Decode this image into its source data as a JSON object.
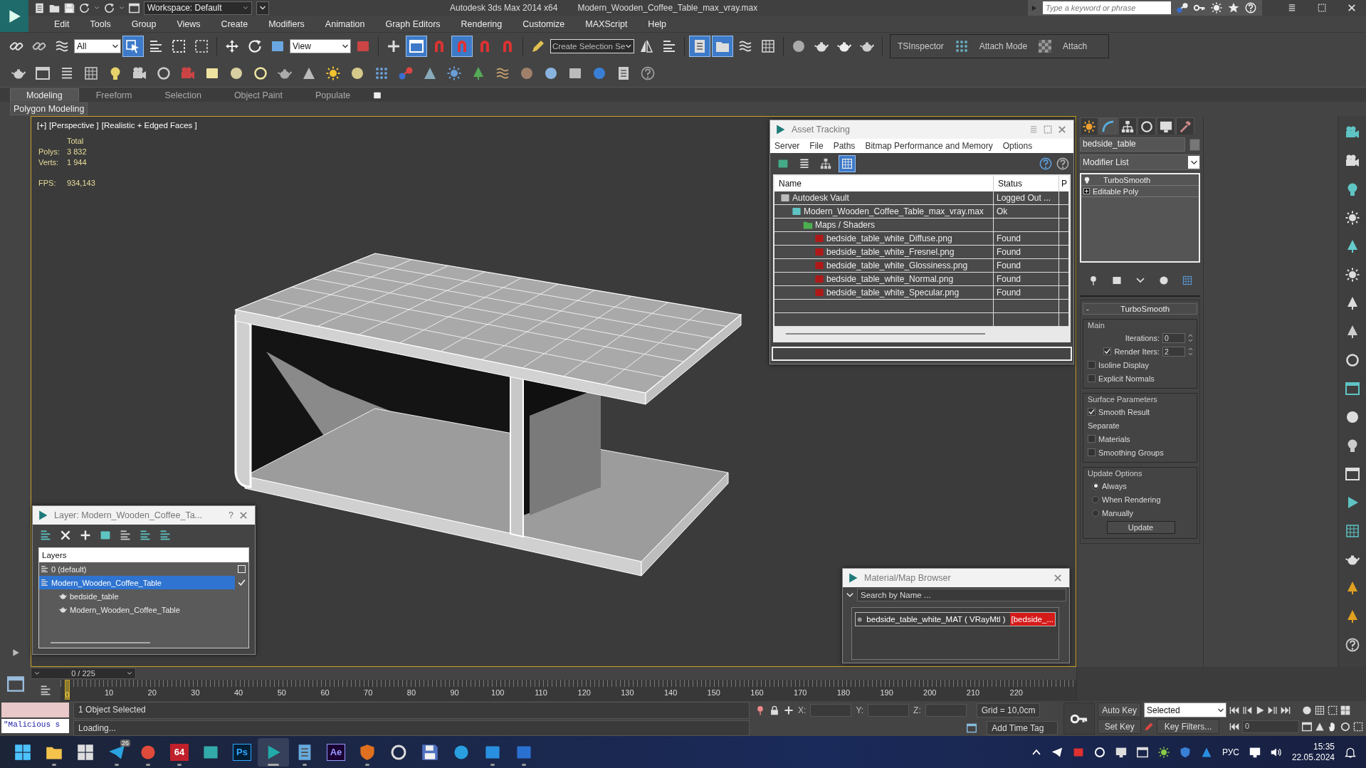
{
  "title_bar": {
    "workspace": "Workspace: Default",
    "app_title": "Autodesk 3ds Max  2014 x64",
    "file_name": "Modern_Wooden_Coffee_Table_max_vray.max",
    "search": {
      "placeholder": "Type a keyword or phrase"
    }
  },
  "menu": [
    "Edit",
    "Tools",
    "Group",
    "Views",
    "Create",
    "Modifiers",
    "Animation",
    "Graph Editors",
    "Rendering",
    "Customize",
    "MAXScript",
    "Help"
  ],
  "main_toolbar": [
    {
      "kind": "button",
      "selected": false
    },
    {
      "kind": "button",
      "selected": false
    },
    {
      "kind": "button",
      "selected": false
    },
    {
      "kind": "dropdown",
      "value": "All"
    },
    {
      "kind": "button",
      "selected": true
    },
    {
      "kind": "button",
      "selected": false
    },
    {
      "kind": "button",
      "selected": false
    },
    {
      "kind": "button",
      "selected": false
    },
    {
      "kind": "sep"
    },
    {
      "kind": "button",
      "selected": false
    },
    {
      "kind": "button",
      "selected": false
    },
    {
      "kind": "button",
      "selected": false
    },
    {
      "kind": "dropdown",
      "value": "View"
    },
    {
      "kind": "button",
      "selected": false
    },
    {
      "kind": "sep"
    },
    {
      "kind": "button",
      "selected": false
    },
    {
      "kind": "button",
      "selected": true
    },
    {
      "kind": "button",
      "selected": false
    },
    {
      "kind": "button",
      "selected": true
    },
    {
      "kind": "button",
      "selected": false
    },
    {
      "kind": "button",
      "selected": false
    },
    {
      "kind": "sep"
    },
    {
      "kind": "button",
      "selected": false
    },
    {
      "kind": "combo",
      "value": "Create Selection Se"
    },
    {
      "kind": "button",
      "selected": false
    },
    {
      "kind": "button",
      "selected": false
    },
    {
      "kind": "sep"
    },
    {
      "kind": "button",
      "selected": true
    },
    {
      "kind": "button",
      "selected": true
    },
    {
      "kind": "button",
      "selected": false
    },
    {
      "kind": "button",
      "selected": false
    },
    {
      "kind": "sep"
    },
    {
      "kind": "button",
      "selected": false
    },
    {
      "kind": "button",
      "selected": false
    },
    {
      "kind": "button",
      "selected": false
    },
    {
      "kind": "button",
      "selected": false
    },
    {
      "kind": "sep"
    },
    {
      "kind": "label",
      "text": "TSInspector"
    },
    {
      "kind": "button",
      "selected": false
    },
    {
      "kind": "label",
      "text": "Attach Mode"
    },
    {
      "kind": "button",
      "selected": false
    },
    {
      "kind": "label",
      "text": "Attach"
    }
  ],
  "ribbon": {
    "tabs": [
      {
        "label": "Modeling",
        "selected": true
      },
      {
        "label": "Freeform",
        "selected": false
      },
      {
        "label": "Selection",
        "selected": false
      },
      {
        "label": "Object Paint",
        "selected": false
      },
      {
        "label": "Populate",
        "selected": false
      }
    ],
    "panel_label": "Polygon Modeling"
  },
  "viewport": {
    "labels": [
      "[+]",
      "[Perspective ]",
      "[Realistic + Edged Faces ]"
    ],
    "stats_header": "Total",
    "stats": [
      {
        "label": "Polys:",
        "value": "3 832"
      },
      {
        "label": "Verts:",
        "value": "1 944"
      }
    ],
    "fps": {
      "label": "FPS:",
      "value": "934,143"
    }
  },
  "asset_tracking": {
    "title": "Asset Tracking",
    "menu": [
      "Server",
      "File",
      "Paths",
      "Bitmap Performance and Memory",
      "Options"
    ],
    "toolbar": [
      {
        "selected": false
      },
      {
        "selected": false
      },
      {
        "selected": false
      },
      {
        "selected": true
      }
    ],
    "columns": [
      "Name",
      "Status",
      "P"
    ],
    "rows": [
      {
        "kind": "vault",
        "name": "Autodesk Vault",
        "status": "Logged Out ...",
        "children": [
          {
            "kind": "scene",
            "name": "Modern_Wooden_Coffee_Table_max_vray.max",
            "status": "Ok",
            "children": [
              {
                "kind": "folder",
                "name": "Maps / Shaders",
                "children": [
                  {
                    "kind": "image",
                    "name": "bedside_table_white_Diffuse.png",
                    "status": "Found"
                  },
                  {
                    "kind": "image",
                    "name": "bedside_table_white_Fresnel.png",
                    "status": "Found"
                  },
                  {
                    "kind": "image",
                    "name": "bedside_table_white_Glossiness.png",
                    "status": "Found"
                  },
                  {
                    "kind": "image",
                    "name": "bedside_table_white_Normal.png",
                    "status": "Found"
                  },
                  {
                    "kind": "image",
                    "name": "bedside_table_white_Specular.png",
                    "status": "Found"
                  }
                ]
              }
            ]
          }
        ]
      }
    ]
  },
  "layer_window": {
    "title": "Layer: Modern_Wooden_Coffee_Ta...",
    "help_glyph": "?",
    "header": "Layers",
    "layers": [
      {
        "name": "0 (default)",
        "selected": false,
        "current": false
      },
      {
        "name": "Modern_Wooden_Coffee_Table",
        "selected": true,
        "current": true,
        "children": [
          {
            "name": "bedside_table",
            "selected": false
          },
          {
            "name": "Modern_Wooden_Coffee_Table",
            "selected": false
          }
        ]
      }
    ]
  },
  "material_browser": {
    "title": "Material/Map Browser",
    "search": {
      "placeholder": "Search by Name ..."
    },
    "items": [
      {
        "label": "bedside_table_white_MAT ( VRayMtl )",
        "tag": "[bedside_...",
        "selected": false
      }
    ]
  },
  "command_panel": {
    "tabs": [
      {
        "selected": false
      },
      {
        "selected": true
      },
      {
        "selected": false
      },
      {
        "selected": false
      },
      {
        "selected": false
      },
      {
        "selected": false
      }
    ],
    "object_name": "bedside_table",
    "modifier_list": "Modifier List",
    "stack": [
      {
        "kind": "modifier",
        "label": "TurboSmooth"
      },
      {
        "kind": "base",
        "label": "Editable Poly",
        "expanded": false
      }
    ],
    "rollout": {
      "title": "TurboSmooth",
      "collapse_glyph": "-",
      "groups": [
        {
          "title": "Main",
          "items": [
            {
              "kind": "spinner",
              "label": "Iterations:",
              "value": "0"
            },
            {
              "kind": "spinner",
              "label": "Render Iters:",
              "value": "2",
              "checked": true
            },
            {
              "kind": "checkbox",
              "label": "Isoline Display",
              "checked": false
            },
            {
              "kind": "checkbox",
              "label": "Explicit Normals",
              "checked": false
            }
          ]
        },
        {
          "title": "Surface Parameters",
          "items": [
            {
              "kind": "checkbox",
              "label": "Smooth Result",
              "checked": true
            },
            {
              "kind": "label",
              "label": "Separate",
              "children": [
                {
                  "kind": "checkbox",
                  "label": "Materials",
                  "checked": false
                },
                {
                  "kind": "checkbox",
                  "label": "Smoothing Groups",
                  "checked": false
                }
              ]
            }
          ]
        },
        {
          "title": "Update Options",
          "items": [
            {
              "kind": "radio",
              "label": "Always",
              "selected": true
            },
            {
              "kind": "radio",
              "label": "When Rendering",
              "selected": false
            },
            {
              "kind": "radio",
              "label": "Manually",
              "selected": false
            },
            {
              "kind": "button",
              "label": "Update"
            }
          ]
        }
      ]
    }
  },
  "timeline": {
    "frame_display": "0 / 225",
    "level": 0,
    "current": "0",
    "ticks": [
      "10",
      "20",
      "30",
      "40",
      "50",
      "60",
      "70",
      "80",
      "90",
      "100",
      "110",
      "120",
      "130",
      "140",
      "150",
      "160",
      "170",
      "180",
      "190",
      "200",
      "210",
      "220"
    ]
  },
  "status": {
    "listener_text": "\"Malicious s",
    "prompt": "1 Object Selected",
    "message": "Loading...",
    "coords": [
      "X:",
      "Y:",
      "Z:"
    ],
    "grid": "Grid = 10,0cm",
    "time_tag": "Add Time Tag",
    "auto_key": "Auto Key",
    "set_key": "Set Key",
    "key_mode": "Selected",
    "key_filters": "Key Filters...",
    "frame_field": "0"
  },
  "taskbar": {
    "apps": [
      {
        "selected": false,
        "running": false
      },
      {
        "selected": false,
        "running": true
      },
      {
        "selected": false,
        "running": false
      },
      {
        "selected": false,
        "running": true,
        "badge": "26"
      },
      {
        "selected": false,
        "running": true
      },
      {
        "selected": false,
        "running": true,
        "label": "64"
      },
      {
        "selected": false,
        "running": false
      },
      {
        "selected": false,
        "running": false,
        "label": "Ps"
      },
      {
        "selected": true,
        "running": true
      },
      {
        "selected": false,
        "running": true
      },
      {
        "selected": false,
        "running": false,
        "label": "Ae"
      },
      {
        "selected": false,
        "running": true
      },
      {
        "selected": false,
        "running": false
      },
      {
        "selected": false,
        "running": false
      },
      {
        "selected": false,
        "running": false
      },
      {
        "selected": false,
        "running": true
      },
      {
        "selected": false,
        "running": true
      }
    ],
    "language": "РУС",
    "time": "15:35",
    "date": "22.05.2024"
  }
}
